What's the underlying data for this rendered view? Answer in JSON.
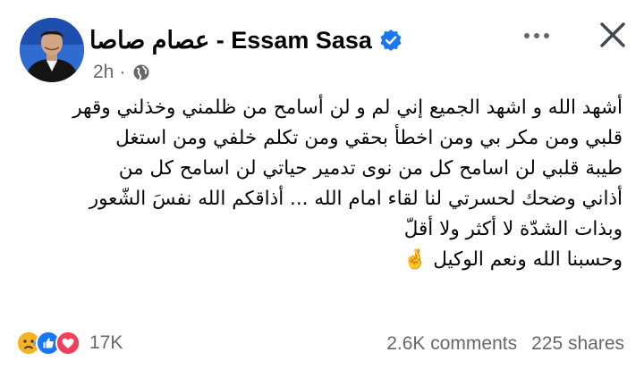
{
  "post": {
    "author": {
      "name": "عصام صاصا - Essam Sasa",
      "verified": true
    },
    "time": "2h",
    "separator": "·",
    "privacy_icon": "globe-icon",
    "text_lines": [
      "أشهد الله و اشهد الجميع إني لم و لن أسامح من ظلمني وخذلني وقهر",
      "قلبي ومن مكر بي ومن اخطأ بحقي  ومن تكلم خلفي ومن استغل",
      "طيبة قلبي لن اسامح كل من نوى تدمير حياتي لن اسامح كل من",
      "أذاني وضحك لحسرتي لنا لقاء امام الله ... أذاقكم الله نفسَ الشّعور",
      "وبذات الشدّة لا أكثر ولا أقلّ",
      "وحسبنا الله ونعم الوكيل 🤞"
    ],
    "reactions": {
      "icons": [
        "sad-icon",
        "like-icon",
        "love-icon"
      ],
      "count": "17K"
    },
    "comments": "2.6K comments",
    "shares": "225 shares"
  },
  "colors": {
    "text": "#050505",
    "secondary_text": "#65676b",
    "verified_blue": "#1877f2",
    "like_blue": "#1877f2",
    "love_red": "#f33e58",
    "sad_yellow": "#f7b125"
  }
}
